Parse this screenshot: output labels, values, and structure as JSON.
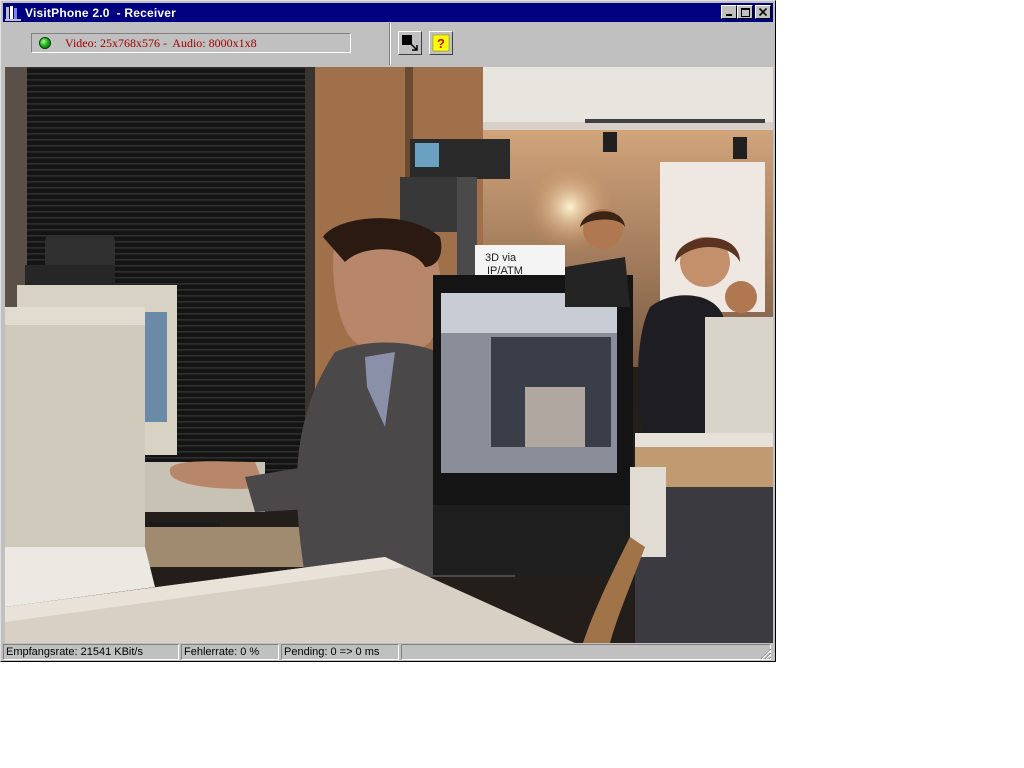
{
  "window": {
    "title": "VisitPhone 2.0  - Receiver"
  },
  "titlebar_buttons": {
    "minimize_icon": "minimize-icon",
    "maximize_icon": "maximize-icon",
    "close_icon": "close-icon"
  },
  "toolbar": {
    "status_text": "Video: 25x768x576 -  Audio: 8000x1x8",
    "status_color": "#a00000",
    "led_color": "#22b022",
    "fullscreen_icon": "fullscreen-toggle-icon",
    "help_icon": "help-question-icon"
  },
  "video": {
    "sign_line1": "3D via",
    "sign_line2": "IP/ATM"
  },
  "statusbar": {
    "receive_rate": "Empfangsrate: 21541 KBit/s",
    "error_rate": "Fehlerrate: 0 %",
    "pending": "Pending: 0 => 0 ms",
    "extra": ""
  },
  "colors": {
    "titlebar": "#000080",
    "face": "#c0c0c0"
  }
}
